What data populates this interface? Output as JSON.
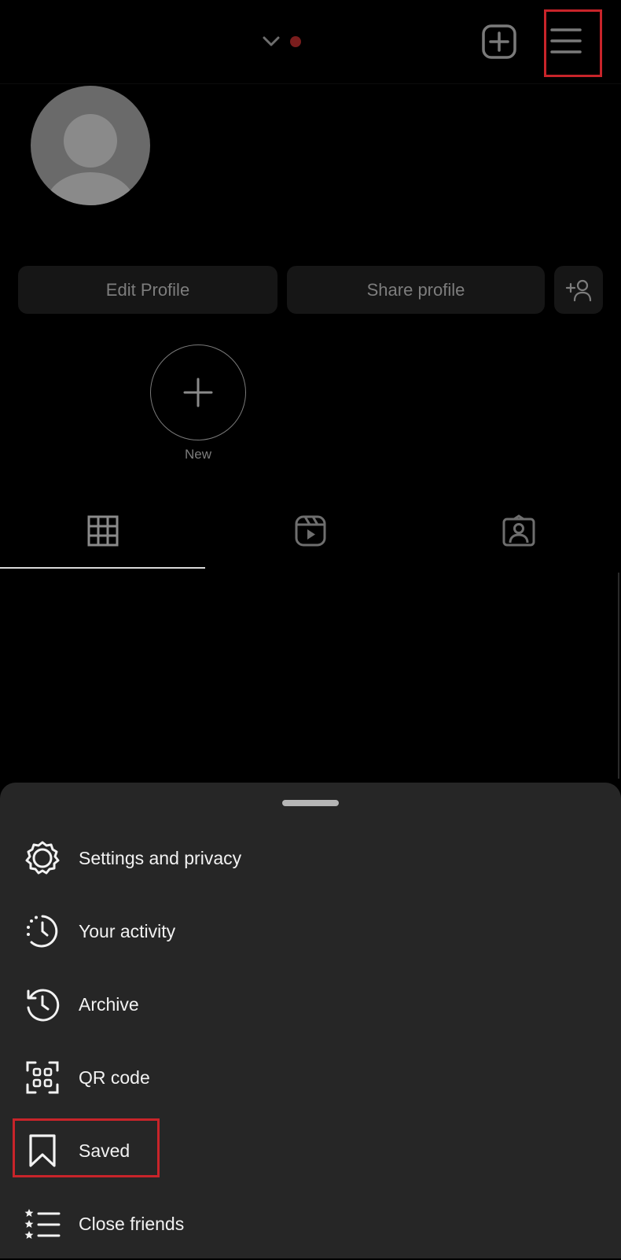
{
  "header": {
    "account_switcher_icon": "chevron-down-icon",
    "new_post_icon": "plus-square-icon",
    "menu_icon": "hamburger-menu-icon"
  },
  "profile": {
    "avatar_icon": "default-avatar",
    "edit_profile_label": "Edit Profile",
    "share_profile_label": "Share profile",
    "discover_people_icon": "add-person-icon"
  },
  "highlights": {
    "new_label": "New"
  },
  "tabs": [
    {
      "icon": "grid-icon",
      "selected": true
    },
    {
      "icon": "reels-icon",
      "selected": false
    },
    {
      "icon": "tagged-person-icon",
      "selected": false
    }
  ],
  "menu_sheet": {
    "items": [
      {
        "label": "Settings and privacy",
        "icon": "gear-icon"
      },
      {
        "label": "Your activity",
        "icon": "activity-clock-icon"
      },
      {
        "label": "Archive",
        "icon": "archive-history-icon"
      },
      {
        "label": "QR code",
        "icon": "qr-code-icon"
      },
      {
        "label": "Saved",
        "icon": "bookmark-icon"
      },
      {
        "label": "Close friends",
        "icon": "close-friends-list-icon"
      }
    ]
  },
  "colors": {
    "background": "#000000",
    "sheet": "#262626",
    "highlight_box": "#c8242a",
    "notification_dot": "#7a1d1d",
    "muted_text": "#7d7d7d"
  }
}
